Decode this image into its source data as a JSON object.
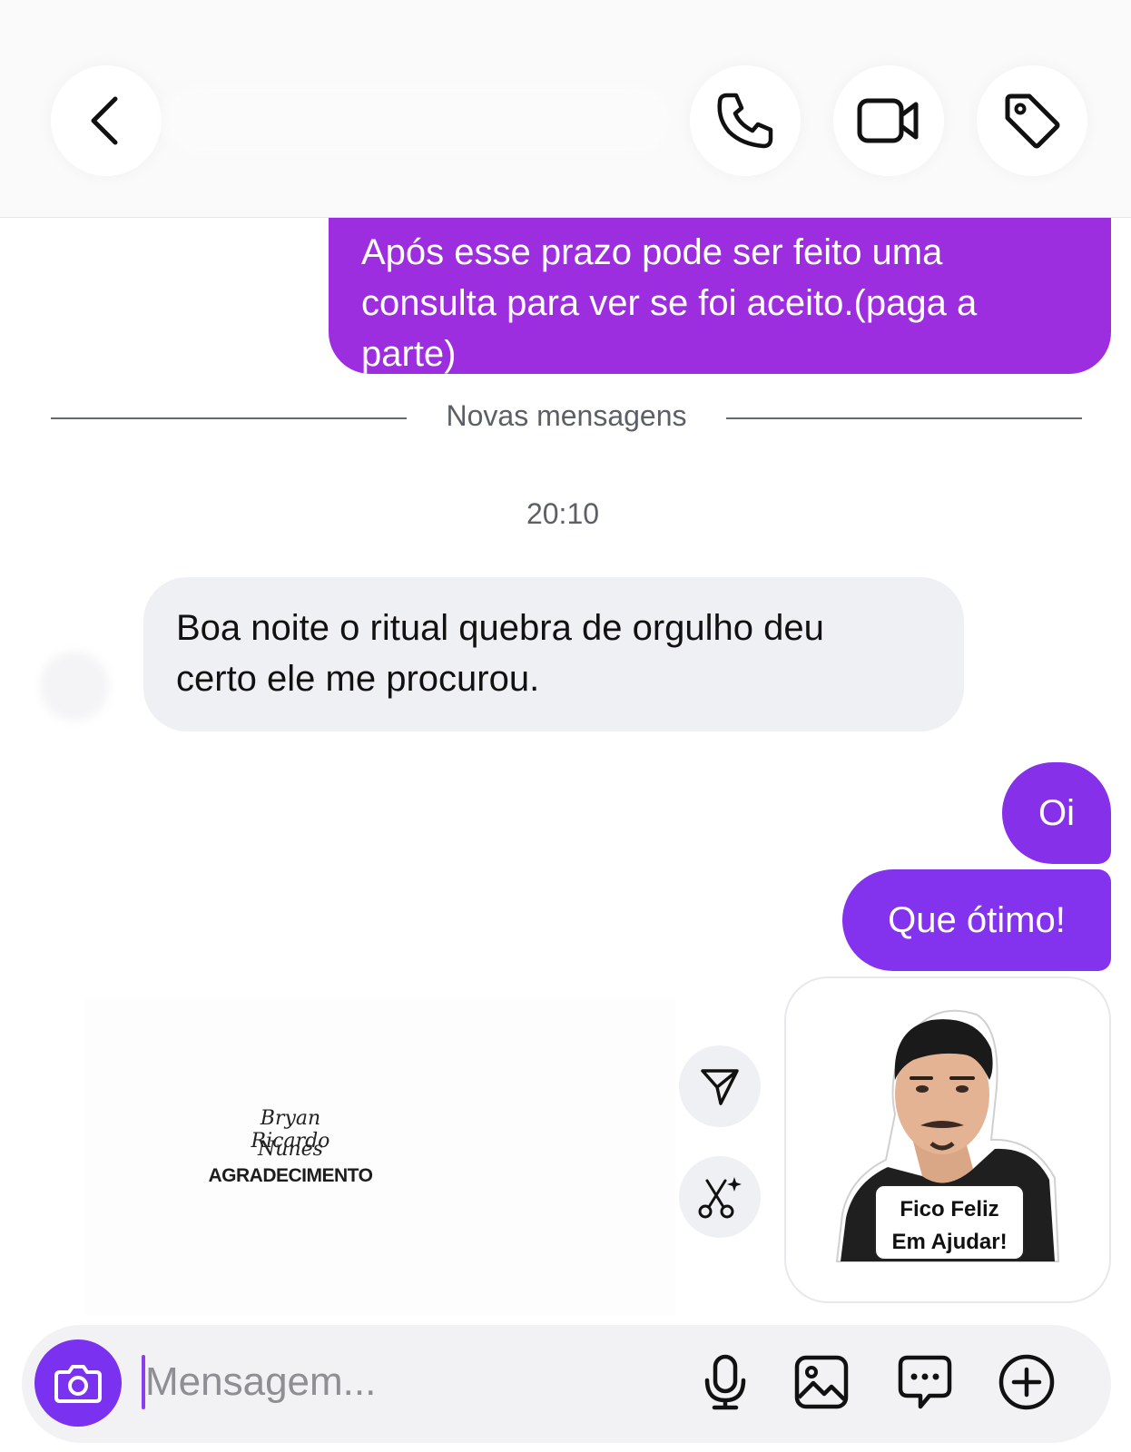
{
  "header": {
    "back_icon": "chevron-left-icon",
    "call_icon": "phone-icon",
    "video_icon": "video-camera-icon",
    "tag_icon": "tag-icon"
  },
  "messages": {
    "top_outgoing": {
      "lines": [
        "Após esse prazo pode ser feito uma",
        "consulta para ver se foi aceito.(paga a",
        "parte)"
      ]
    },
    "divider_label": "Novas mensagens",
    "timestamp": "20:10",
    "incoming": {
      "lines": [
        "Boa noite o ritual quebra de orgulho deu",
        "certo ele me procurou."
      ]
    },
    "outgoing_oi": "Oi",
    "outgoing_otimo": "Que ótimo!",
    "sticker": {
      "caption_line1": "Fico Feliz",
      "caption_line2": "Em Ajudar!"
    }
  },
  "watermark": {
    "signature_line1": "Bryan Ricardo",
    "signature_line2": "Nunes",
    "label": "AGRADECIMENTO"
  },
  "side_actions": {
    "share_icon": "send-icon",
    "cut_icon": "scissors-sparkle-icon"
  },
  "composer": {
    "placeholder": "Mensagem...",
    "value": "",
    "icons": [
      "camera-icon",
      "microphone-icon",
      "gallery-icon",
      "sticker-icon",
      "plus-circle-icon"
    ]
  },
  "colors": {
    "outgoing_bubble_top": "#9d2ee0",
    "outgoing_bubble_oi": "#8630ea",
    "outgoing_bubble_otimo": "#8332ee",
    "incoming_bubble": "#eff0f3",
    "camera_button": "#7b32f0",
    "divider_text": "#5c6066"
  }
}
